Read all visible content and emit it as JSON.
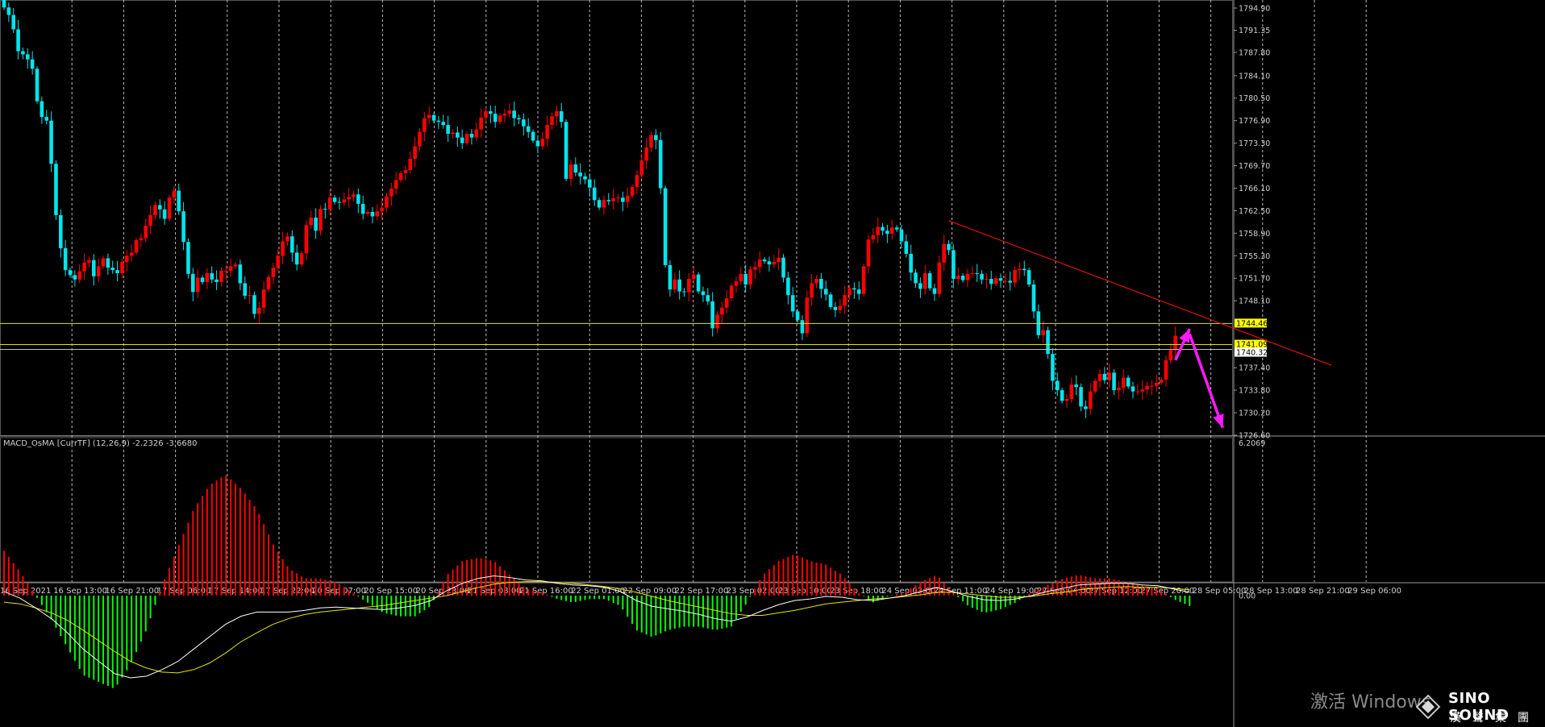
{
  "chart_data": {
    "type": "candlestick",
    "instrument_note": "XAUUSD H1",
    "price_axis": {
      "min": 1726.6,
      "max": 1794.9,
      "ticks": [
        "1794.90",
        "1791.35",
        "1787.80",
        "1784.10",
        "1780.50",
        "1776.90",
        "1773.30",
        "1769.70",
        "1766.10",
        "1762.50",
        "1758.90",
        "1755.30",
        "1751.70",
        "1748.10",
        "1737.40",
        "1733.80",
        "1730.20",
        "1726.60"
      ]
    },
    "time_labels": [
      "16 Sep 2021",
      "16 Sep 13:00",
      "16 Sep 21:00",
      "17 Sep 06:00",
      "17 Sep 14:00",
      "17 Sep 22:00",
      "20 Sep 07:00",
      "20 Sep 15:00",
      "20 Sep 23:00",
      "21 Sep 08:00",
      "21 Sep 16:00",
      "22 Sep 01:00",
      "22 Sep 09:00",
      "22 Sep 17:00",
      "23 Sep 02:00",
      "23 Sep 10:00",
      "23 Sep 18:00",
      "24 Sep 03:00",
      "24 Sep 11:00",
      "24 Sep 19:00",
      "27 Sep 04:00",
      "27 Sep 12:00",
      "27 Sep 20:00",
      "28 Sep 05:00",
      "28 Sep 13:00",
      "28 Sep 21:00",
      "29 Sep 06:00"
    ],
    "horizontal_levels": [
      {
        "price": 1744.46,
        "label": "1744.46",
        "color": "#e6e600",
        "tag_bg": "#ffff00"
      },
      {
        "price": 1741.09,
        "label": "1741.09",
        "color": "#e6e600",
        "tag_bg": "#ffff00"
      },
      {
        "price": 1740.32,
        "label": "1740.32",
        "color": "#c0c0c0",
        "tag_bg": "#ffffff"
      }
    ],
    "trendline": {
      "color": "#e01010",
      "from": {
        "bar": 200,
        "price": 1760.9
      },
      "to": {
        "bar": 281,
        "price": 1737.8
      }
    },
    "projection_arrows": {
      "color": "#ff1aff",
      "up": {
        "from": [
          248,
          1738.6
        ],
        "to": [
          251,
          1743.6
        ]
      },
      "down": {
        "from": [
          251,
          1742.8
        ],
        "to": [
          258,
          1727.8
        ]
      }
    },
    "candles_up_color": "#ff0000",
    "candles_down_color": "#00e5ee",
    "closes": [
      1795.0,
      1793.8,
      1791.5,
      1788.0,
      1787.5,
      1786.7,
      1785.2,
      1780.0,
      1777.5,
      1776.9,
      1770.0,
      1761.8,
      1756.5,
      1753.0,
      1752.2,
      1751.5,
      1752.8,
      1754.2,
      1754.6,
      1752.0,
      1753.6,
      1754.9,
      1753.4,
      1753.0,
      1752.5,
      1754.3,
      1755.3,
      1755.8,
      1757.8,
      1758.1,
      1760.1,
      1761.8,
      1763.4,
      1762.7,
      1761.2,
      1764.6,
      1765.7,
      1762.4,
      1757.5,
      1752.4,
      1749.5,
      1751.8,
      1751.1,
      1752.5,
      1751.5,
      1751.1,
      1752.9,
      1752.9,
      1753.6,
      1753.9,
      1750.9,
      1748.9,
      1749.0,
      1746.0,
      1747.0,
      1749.9,
      1751.9,
      1753.4,
      1755.3,
      1757.6,
      1758.4,
      1755.8,
      1753.9,
      1755.7,
      1760.2,
      1761.4,
      1759.3,
      1762.8,
      1762.7,
      1764.6,
      1763.9,
      1763.8,
      1764.3,
      1764.7,
      1765.1,
      1763.6,
      1762.0,
      1762.3,
      1761.6,
      1762.4,
      1763.0,
      1764.8,
      1766.0,
      1767.4,
      1768.5,
      1769.0,
      1770.8,
      1772.8,
      1775.1,
      1777.3,
      1777.8,
      1776.9,
      1776.7,
      1776.2,
      1774.8,
      1775.0,
      1774.2,
      1773.3,
      1774.8,
      1774.2,
      1775.5,
      1777.4,
      1778.4,
      1778.0,
      1776.7,
      1777.7,
      1778.0,
      1778.5,
      1777.3,
      1777.1,
      1776.0,
      1775.1,
      1773.7,
      1772.8,
      1774.0,
      1776.2,
      1777.6,
      1778.4,
      1776.7,
      1767.6,
      1769.9,
      1768.6,
      1768.0,
      1767.5,
      1766.2,
      1764.2,
      1763.0,
      1764.2,
      1764.0,
      1764.5,
      1764.6,
      1763.9,
      1764.9,
      1766.3,
      1768.2,
      1770.5,
      1772.6,
      1774.6,
      1773.8,
      1766.1,
      1753.8,
      1749.9,
      1751.5,
      1749.6,
      1749.5,
      1751.6,
      1752.3,
      1749.6,
      1749.0,
      1748.0,
      1743.7,
      1745.9,
      1747.0,
      1748.5,
      1750.5,
      1751.2,
      1752.4,
      1750.7,
      1753.1,
      1753.5,
      1754.7,
      1754.4,
      1753.9,
      1754.3,
      1755.0,
      1751.8,
      1749.0,
      1746.4,
      1745.0,
      1742.9,
      1748.6,
      1750.9,
      1751.6,
      1750.0,
      1749.1,
      1747.1,
      1746.6,
      1747.3,
      1749.0,
      1750.1,
      1749.9,
      1749.2,
      1753.6,
      1757.9,
      1758.6,
      1759.9,
      1759.3,
      1758.8,
      1759.8,
      1759.5,
      1757.6,
      1755.6,
      1752.6,
      1750.9,
      1750.0,
      1752.5,
      1750.1,
      1749.2,
      1754.2,
      1757.2,
      1756.2,
      1751.6,
      1752.1,
      1751.4,
      1752.4,
      1752.5,
      1752.4,
      1751.5,
      1751.6,
      1750.8,
      1751.7,
      1751.3,
      1751.3,
      1751.0,
      1753.0,
      1753.2,
      1753.0,
      1750.7,
      1746.4,
      1742.6,
      1743.4,
      1739.6,
      1735.3,
      1733.8,
      1732.1,
      1732.4,
      1734.7,
      1734.3,
      1731.2,
      1730.8,
      1733.6,
      1735.3,
      1736.4,
      1735.4,
      1736.6,
      1733.8,
      1734.2,
      1735.8,
      1734.4,
      1733.6,
      1733.6,
      1733.9,
      1734.5,
      1734.5,
      1735.0,
      1735.5,
      1738.6,
      1740.2,
      1742.5
    ],
    "osma": {
      "label": "MACD_OsMA [CurrTF] (12,26,9) -2.2326 -3.6680",
      "top": 6.2069,
      "zero_tick": "0.00",
      "top_tick": "6.2069",
      "positive_color": "#ff0000",
      "negative_color": "#00ff00",
      "macd_color": "#ffffff",
      "signal_color": "#e6e600"
    },
    "macd_line": [
      0.5,
      -0.3,
      -1.5,
      -2.8,
      -4.5,
      -6.5,
      -8.0,
      -9.5,
      -10.0,
      -9.8,
      -9.0,
      -8.0,
      -6.5,
      -5.0,
      -3.5,
      -2.5,
      -2.0,
      -2.0,
      -2.0,
      -1.8,
      -1.5,
      -1.4,
      -1.5,
      -1.6,
      -1.7,
      -1.5,
      -1.2,
      -0.6,
      0.6,
      1.5,
      2.1,
      2.4,
      2.2,
      1.9,
      1.8,
      1.5,
      1.3,
      1.2,
      1.0,
      0.5,
      -0.6,
      -1.3,
      -1.6,
      -1.9,
      -2.3,
      -2.8,
      -3.1,
      -2.6,
      -1.8,
      -1.1,
      -0.6,
      -0.4,
      -0.1,
      -0.2,
      -0.5,
      -0.6,
      -0.3,
      0.0,
      0.5,
      1.0,
      0.5,
      -0.1,
      -0.5,
      -0.6,
      -0.4,
      0.0,
      0.5,
      0.9,
      1.3,
      1.4,
      1.5,
      1.5,
      1.3,
      1.2,
      0.8,
      0.4
    ],
    "signal_line": [
      -0.8,
      -1.0,
      -1.5,
      -2.1,
      -3.0,
      -4.2,
      -5.5,
      -6.8,
      -8.0,
      -8.8,
      -9.3,
      -9.4,
      -9.0,
      -8.2,
      -7.0,
      -5.6,
      -4.5,
      -3.5,
      -2.8,
      -2.3,
      -2.0,
      -1.8,
      -1.6,
      -1.4,
      -1.2,
      -0.9,
      -0.6,
      -0.3,
      0.0,
      0.5,
      1.0,
      1.4,
      1.6,
      1.7,
      1.7,
      1.6,
      1.5,
      1.3,
      1.1,
      0.8,
      0.4,
      -0.1,
      -0.6,
      -1.0,
      -1.4,
      -1.8,
      -2.2,
      -2.4,
      -2.4,
      -2.1,
      -1.8,
      -1.4,
      -1.0,
      -0.8,
      -0.6,
      -0.4,
      -0.3,
      -0.1,
      0.1,
      0.4,
      0.4,
      0.2,
      0.0,
      -0.2,
      -0.2,
      -0.1,
      0.2,
      0.4,
      0.7,
      0.9,
      1.0,
      1.1,
      1.0,
      1.0,
      0.9,
      0.7
    ]
  },
  "watermark": {
    "text": "激活 Windows"
  },
  "logo": {
    "line1": "SINO SOUND",
    "line2": "漢聲集團",
    "icon": "diamond-logo-icon"
  }
}
